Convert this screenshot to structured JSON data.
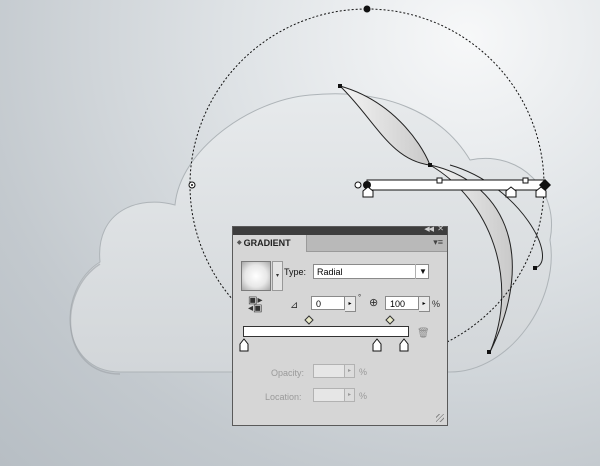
{
  "panel": {
    "tab_label": "GRADIENT",
    "type_label": "Type:",
    "type_value": "Radial",
    "angle_value": "0",
    "degree_symbol": "°",
    "aspect_value": "100",
    "percent_symbol": "%",
    "opacity_label": "Opacity:",
    "location_label": "Location:"
  },
  "gradient": {
    "stop_colors": [
      "#ffffff",
      "#ffffff",
      "#ffffff"
    ],
    "stop_positions": [
      0,
      0.8,
      1.0
    ],
    "midpoints": [
      0.4,
      0.9
    ]
  },
  "colors": {
    "panel_bg": "#d6d6d6",
    "titlebar": "#3d3d3d",
    "canvas_bg": "#c7ccd0"
  },
  "icons": [
    "double-arrow-icon",
    "close-icon",
    "panel-menu-icon",
    "reverse-gradient-icon",
    "angle-icon",
    "aspect-ratio-icon",
    "trash-icon",
    "resize-grip-icon"
  ]
}
